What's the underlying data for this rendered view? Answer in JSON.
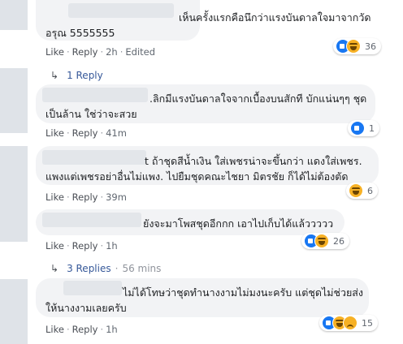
{
  "comments": [
    {
      "text_lines": [
        "เห็นครั้งแรกคือนึกว่าแรงบันดาลใจมาจากวัด",
        "อรุณ 5555555"
      ],
      "actions": {
        "like": "Like",
        "reply": "Reply",
        "time": "2h",
        "edited": "Edited"
      },
      "reactions": {
        "icons": [
          "like",
          "haha"
        ],
        "count": "36"
      }
    },
    {
      "text_lines": [
        ".ลิกมีแรงบันดาลใจจากเบื้องบนสักที บักแน่นๆๆ ชุด",
        "เป็นล้าน ใช่ว่าจะสวย"
      ],
      "actions": {
        "like": "Like",
        "reply": "Reply",
        "time": "41m"
      },
      "reactions": {
        "icons": [
          "like"
        ],
        "count": "1"
      }
    },
    {
      "text_lines": [
        "t ถ้าชุดสีน้ำเงิน ใส่เพชรน่าจะขึ้นกว่า แดงใส่เพชร.",
        "แพงแต่เพชรอย่าอื่นไม่แพง. ไปยืมชุดคณะไชยา มิตรชัย ก็ได้ไม่ต้องตัด"
      ],
      "actions": {
        "like": "Like",
        "reply": "Reply",
        "time": "39m"
      },
      "reactions": {
        "icons": [
          "haha"
        ],
        "count": "6"
      }
    },
    {
      "text_lines": [
        "ยังจะมาโพสชุดอีกกก เอาไปเก็บได้แล้ววววว"
      ],
      "actions": {
        "like": "Like",
        "reply": "Reply",
        "time": "1h"
      },
      "reactions": {
        "icons": [
          "like",
          "haha"
        ],
        "count": "26"
      }
    },
    {
      "text_lines": [
        "ไม่ได้โทษว่าชุดทำนางงามไม่มงนะครับ แต่ชุดไม่ช่วยส่ง",
        "ให้นางงามเลยครับ"
      ],
      "actions": {
        "like": "Like",
        "reply": "Reply",
        "time": "1h"
      },
      "reactions": {
        "icons": [
          "like",
          "haha",
          "sad"
        ],
        "count": "15"
      }
    }
  ],
  "replies_links": [
    {
      "label": "1 Reply"
    },
    {
      "label": "3 Replies",
      "time": "56 mins"
    }
  ],
  "colors": {
    "link": "#365899",
    "bubble": "#f2f3f5",
    "like_blue": "#1877f2",
    "haha_yellow": "#f7b125"
  }
}
